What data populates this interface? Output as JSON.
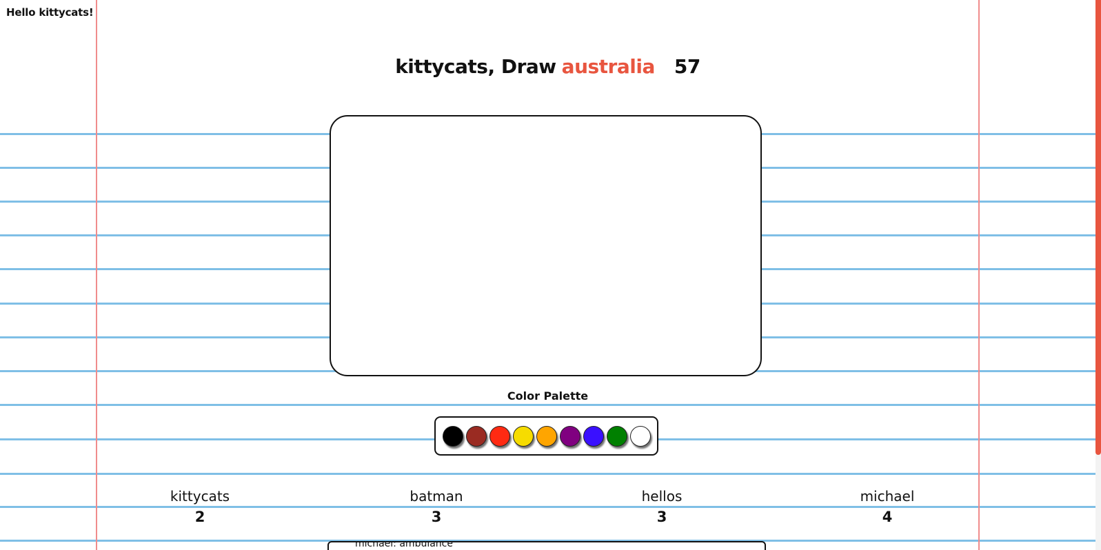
{
  "greeting": "Hello kittycats!",
  "round": {
    "drawer": "kittycats, Draw",
    "word": "australia",
    "timer": "57"
  },
  "palette": {
    "label": "Color Palette",
    "colors": [
      {
        "name": "black",
        "hex": "#000000"
      },
      {
        "name": "brown",
        "hex": "#9a2b22"
      },
      {
        "name": "red",
        "hex": "#ff2a12"
      },
      {
        "name": "yellow",
        "hex": "#f6dc00"
      },
      {
        "name": "orange",
        "hex": "#ffa500"
      },
      {
        "name": "purple",
        "hex": "#800080"
      },
      {
        "name": "blue",
        "hex": "#3a10ff"
      },
      {
        "name": "green",
        "hex": "#008000"
      },
      {
        "name": "white",
        "hex": "#ffffff"
      }
    ]
  },
  "players": [
    {
      "name": "kittycats",
      "score": "2"
    },
    {
      "name": "batman",
      "score": "3"
    },
    {
      "name": "hellos",
      "score": "3"
    },
    {
      "name": "michael",
      "score": "4"
    }
  ],
  "chat": {
    "messages": [
      "michael: ambulance"
    ]
  },
  "theme": {
    "accent": "#e8553f",
    "ruled_line": "#7fbfe6",
    "margin_line": "#f08c8c"
  }
}
